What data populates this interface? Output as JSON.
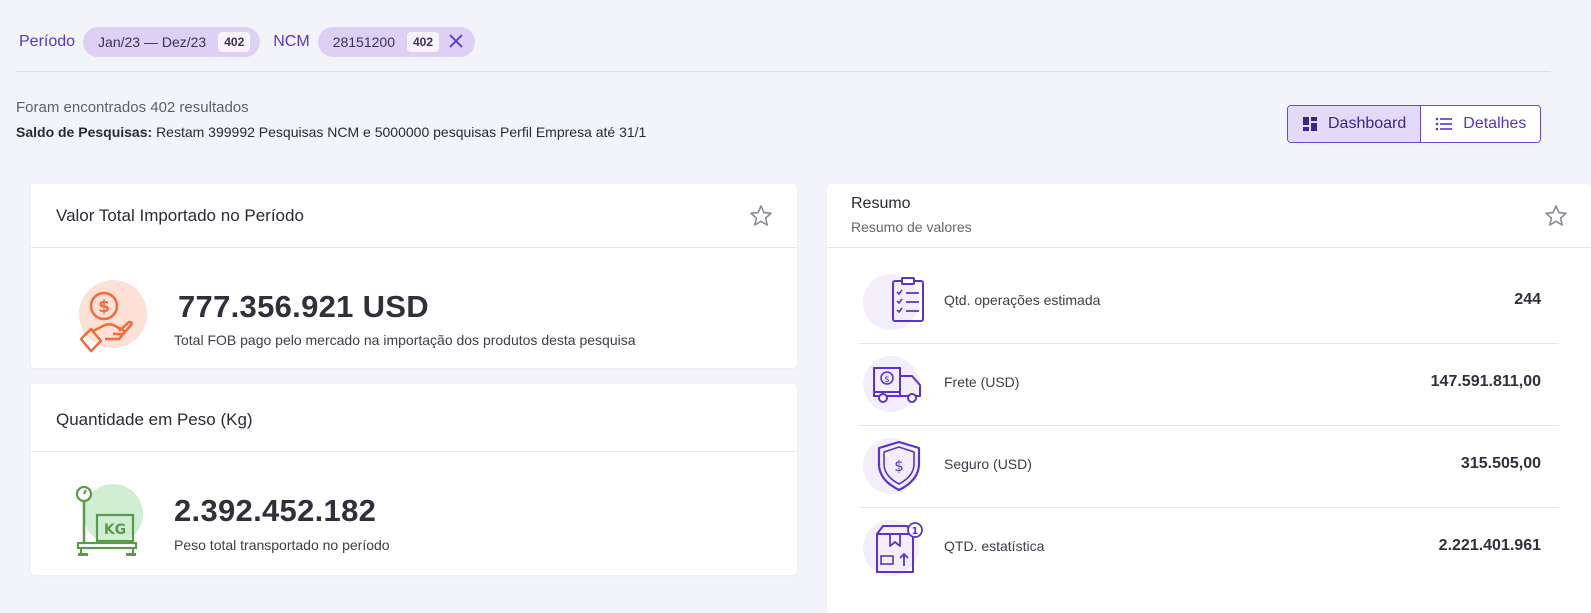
{
  "filters": {
    "periodo_label": "Período",
    "periodo_chip": "Jan/23 — Dez/23",
    "periodo_count": "402",
    "ncm_label": "NCM",
    "ncm_chip": "28151200",
    "ncm_count": "402"
  },
  "results_text": "Foram encontrados 402 resultados",
  "saldo": {
    "label": "Saldo de Pesquisas:",
    "text": "Restam 399992 Pesquisas NCM e 5000000 pesquisas Perfil Empresa até 31/1"
  },
  "view_toggle": {
    "dashboard_label": "Dashboard",
    "detalhes_label": "Detalhes"
  },
  "valor_card": {
    "title": "Valor Total Importado no Período",
    "value": "777.356.921 USD",
    "description": "Total FOB pago pelo mercado na importação dos produtos desta pesquisa"
  },
  "peso_card": {
    "title": "Quantidade em Peso (Kg)",
    "value": "2.392.452.182",
    "description": "Peso total transportado no período",
    "icon_text": "KG"
  },
  "resumo_card": {
    "title": "Resumo",
    "subtitle": "Resumo de valores",
    "rows": [
      {
        "label": "Qtd. operações estimada",
        "value": "244",
        "icon": "clipboard-icon"
      },
      {
        "label": "Frete (USD)",
        "value": "147.591.811,00",
        "icon": "truck-icon"
      },
      {
        "label": "Seguro (USD)",
        "value": "315.505,00",
        "icon": "shield-icon"
      },
      {
        "label": "QTD. estatística",
        "value": "2.221.401.961",
        "icon": "box-icon"
      }
    ]
  },
  "colors": {
    "accent": "#5b33c9",
    "chip_bg": "#dcd1f5",
    "orange_icon": "#f26b3a",
    "green_icon": "#5a9a4a"
  }
}
